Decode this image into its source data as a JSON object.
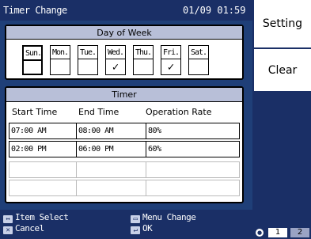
{
  "header": {
    "title": "Timer Change",
    "datetime": "01/09 01:59"
  },
  "day_of_week": {
    "heading": "Day of Week",
    "days": [
      {
        "label": "Sun.",
        "checked": false,
        "selected": true
      },
      {
        "label": "Mon.",
        "checked": false,
        "selected": false
      },
      {
        "label": "Tue.",
        "checked": false,
        "selected": false
      },
      {
        "label": "Wed.",
        "checked": true,
        "selected": false
      },
      {
        "label": "Thu.",
        "checked": false,
        "selected": false
      },
      {
        "label": "Fri.",
        "checked": true,
        "selected": false
      },
      {
        "label": "Sat.",
        "checked": false,
        "selected": false
      }
    ],
    "check_mark": "✓"
  },
  "timer": {
    "heading": "Timer",
    "columns": [
      "Start Time",
      "End Time",
      "Operation Rate"
    ],
    "rows": [
      {
        "start": "07:00 AM",
        "end": "08:00 AM",
        "rate": "80%"
      },
      {
        "start": "02:00 PM",
        "end": "06:00 PM",
        "rate": "60%"
      },
      {
        "start": "",
        "end": "",
        "rate": ""
      },
      {
        "start": "",
        "end": "",
        "rate": ""
      }
    ]
  },
  "footer": {
    "item_select": "Item Select",
    "cancel": "Cancel",
    "menu_change": "Menu Change",
    "ok": "OK",
    "icons": {
      "item_select": "left-right-arrow-icon",
      "cancel": "cancel-icon",
      "menu_change": "menu-icon",
      "ok": "enter-icon"
    }
  },
  "side": {
    "setting": "Setting",
    "clear": "Clear"
  },
  "pager": {
    "page1": "1",
    "page2": "2",
    "current": 1
  },
  "colors": {
    "panel": "#1f3f78",
    "bar": "#1a2f66",
    "heading_fill": "#b8bfd8"
  }
}
